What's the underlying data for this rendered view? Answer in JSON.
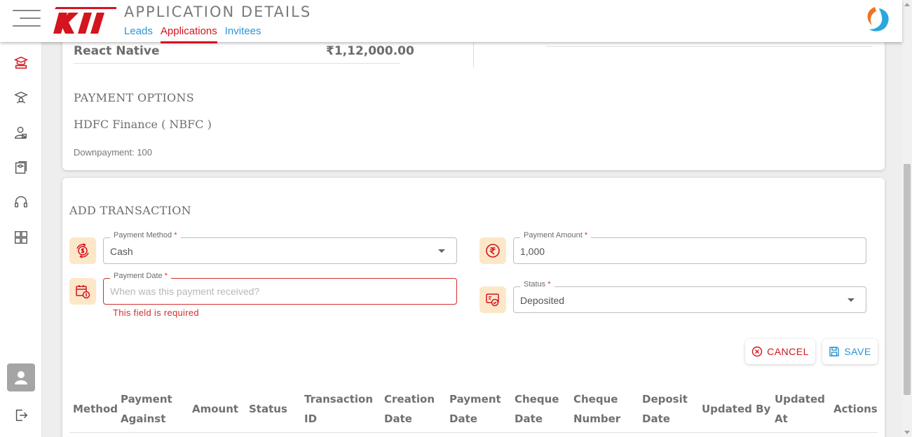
{
  "header": {
    "title": "APPLICATION DETAILS",
    "nav": [
      {
        "label": "Leads",
        "active": false
      },
      {
        "label": "Applications",
        "active": true
      },
      {
        "label": "Invitees",
        "active": false
      }
    ],
    "logo_icon": "kii-logo",
    "brand_icon": "swirl-brand-icon"
  },
  "sidebar": {
    "icons": [
      "courses-icon",
      "graduation-cap-icon",
      "user-badge-icon",
      "certificate-icon",
      "headset-icon",
      "dashboard-grid-icon"
    ],
    "avatar_icon": "user-avatar-icon",
    "logout_icon": "logout-icon"
  },
  "course": {
    "name": "React Native",
    "price": "₹1,12,000.00"
  },
  "payment_options": {
    "title": "PAYMENT OPTIONS",
    "option": "HDFC Finance ( NBFC )",
    "downpayment": "Downpayment: 100"
  },
  "transaction": {
    "title": "ADD TRANSACTION",
    "payment_method": {
      "label": "Payment Method",
      "required": "*",
      "value": "Cash"
    },
    "payment_amount": {
      "label": "Payment Amount",
      "required": "*",
      "value": "1,000"
    },
    "payment_date": {
      "label": "Payment Date",
      "required": "*",
      "placeholder": "When was this payment received?",
      "error": "This field is required"
    },
    "status": {
      "label": "Status",
      "required": "*",
      "value": "Deposited"
    },
    "cancel_label": "CANCEL",
    "save_label": "SAVE"
  },
  "table": {
    "headers": [
      [
        "Method"
      ],
      [
        "Payment",
        "Against"
      ],
      [
        "Amount"
      ],
      [
        "Status"
      ],
      [
        "Transaction",
        "ID"
      ],
      [
        "Creation",
        "Date"
      ],
      [
        "Payment",
        "Date"
      ],
      [
        "Cheque",
        "Date"
      ],
      [
        "Cheque",
        "Number"
      ],
      [
        "Deposit",
        "Date"
      ],
      [
        "Updated By"
      ],
      [
        "Updated",
        "At"
      ],
      [
        "Actions"
      ]
    ]
  },
  "colors": {
    "accent_red": "#d4141f",
    "link_blue": "#2a94d6",
    "icon_bg": "#fde7c9",
    "error": "#d32f2f"
  }
}
